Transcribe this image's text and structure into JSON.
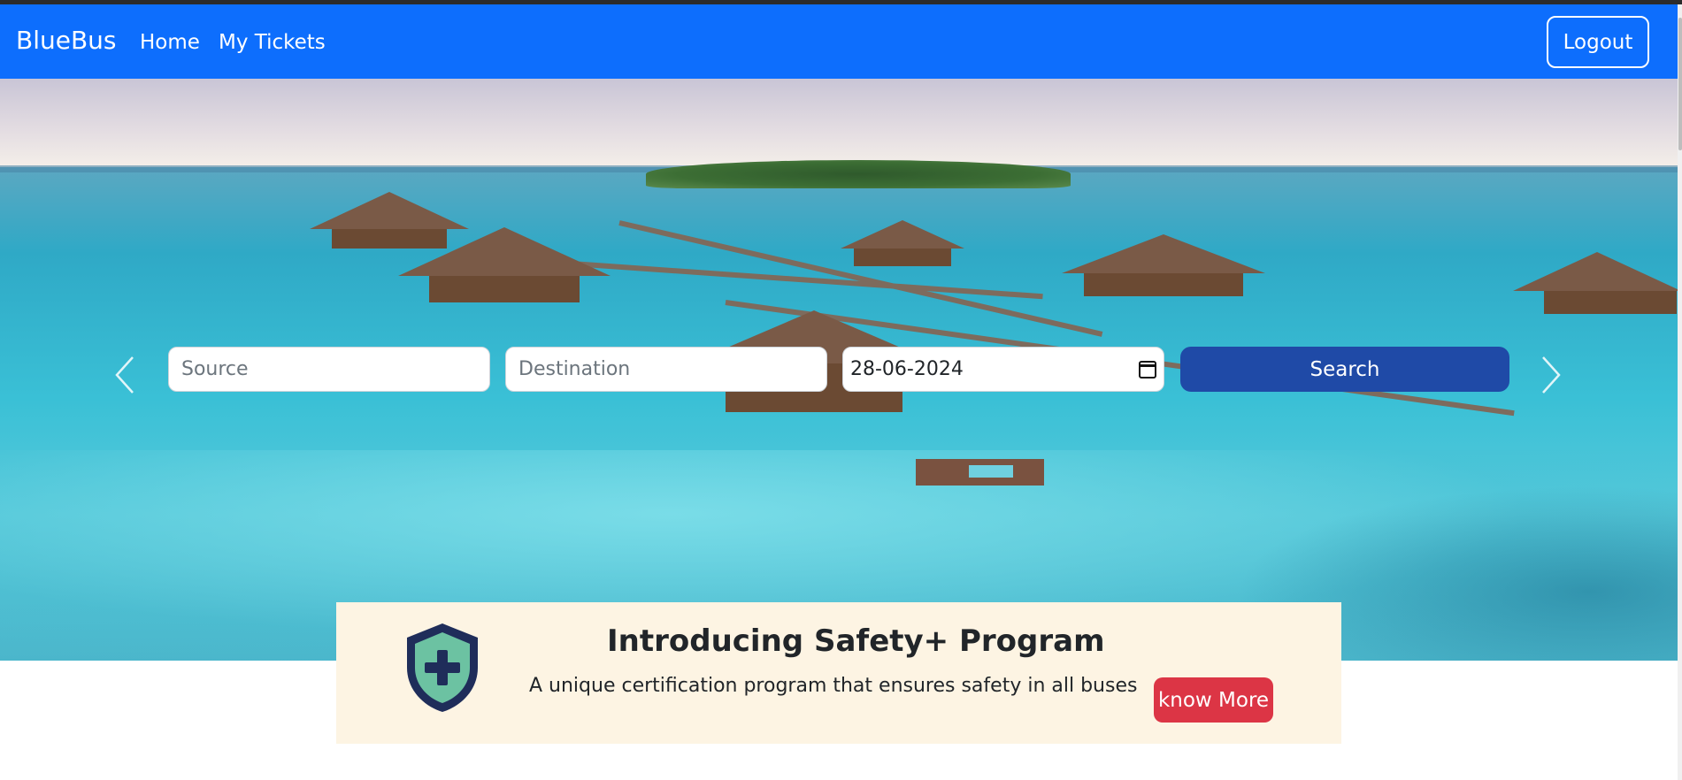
{
  "navbar": {
    "brand": "BlueBus",
    "links": [
      "Home",
      "My Tickets"
    ],
    "logout_label": "Logout",
    "bg_color": "#0d6efd"
  },
  "search": {
    "source_placeholder": "Source",
    "destination_placeholder": "Destination",
    "date_value": "28-06-2024",
    "search_label": "Search",
    "button_color": "#1f4aa7"
  },
  "carousel": {
    "prev_icon": "chevron-left-icon",
    "next_icon": "chevron-right-icon"
  },
  "safety": {
    "title": "Introducing Safety+ Program",
    "subtitle": "A unique certification program that ensures safety in all buses",
    "button_label": "know More",
    "button_color": "#dc3545",
    "icon": "shield-plus-icon",
    "bg_color": "#fdf4e3"
  }
}
